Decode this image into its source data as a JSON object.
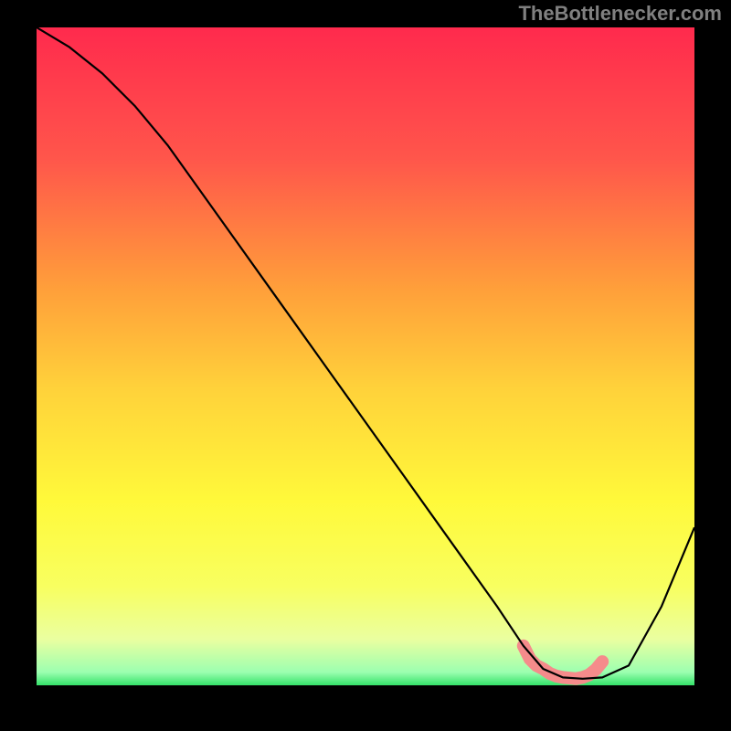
{
  "watermark": "TheBottlenecker.com",
  "chart_data": {
    "type": "line",
    "title": "",
    "xlabel": "",
    "ylabel": "",
    "xlim": [
      0,
      100
    ],
    "ylim": [
      0,
      100
    ],
    "series": [
      {
        "name": "bottleneck-curve",
        "x": [
          0,
          5,
          10,
          15,
          20,
          25,
          30,
          35,
          40,
          45,
          50,
          55,
          60,
          65,
          70,
          74,
          77,
          80,
          83,
          86,
          90,
          95,
          100
        ],
        "y": [
          100,
          97,
          93,
          88,
          82,
          75,
          68,
          61,
          54,
          47,
          40,
          33,
          26,
          19,
          12,
          6,
          2.5,
          1.2,
          1.0,
          1.2,
          3,
          12,
          24
        ]
      },
      {
        "name": "optimal-band",
        "x": [
          74,
          75,
          76,
          77,
          78,
          79,
          80,
          81,
          82,
          83,
          84,
          85,
          86
        ],
        "y": [
          6.0,
          4.0,
          3.0,
          2.5,
          1.8,
          1.4,
          1.2,
          1.1,
          1.0,
          1.2,
          1.6,
          2.4,
          3.6
        ]
      }
    ],
    "gradient_stops": [
      {
        "offset": 0.0,
        "color": "#ff2a4d"
      },
      {
        "offset": 0.2,
        "color": "#ff564b"
      },
      {
        "offset": 0.4,
        "color": "#ffa03a"
      },
      {
        "offset": 0.55,
        "color": "#ffd23a"
      },
      {
        "offset": 0.72,
        "color": "#fff93a"
      },
      {
        "offset": 0.85,
        "color": "#f8ff60"
      },
      {
        "offset": 0.93,
        "color": "#eaffa0"
      },
      {
        "offset": 0.98,
        "color": "#9cffb0"
      },
      {
        "offset": 1.0,
        "color": "#34e26a"
      }
    ],
    "curve_color": "#000000",
    "band_color": "#f58b8b"
  }
}
